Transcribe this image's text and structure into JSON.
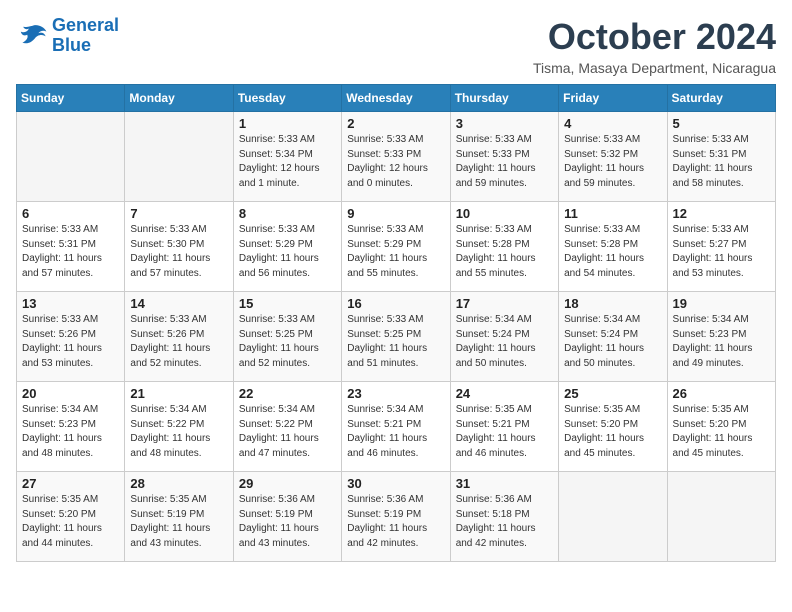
{
  "logo": {
    "line1": "General",
    "line2": "Blue"
  },
  "title": "October 2024",
  "location": "Tisma, Masaya Department, Nicaragua",
  "headers": [
    "Sunday",
    "Monday",
    "Tuesday",
    "Wednesday",
    "Thursday",
    "Friday",
    "Saturday"
  ],
  "weeks": [
    [
      {
        "day": "",
        "info": ""
      },
      {
        "day": "",
        "info": ""
      },
      {
        "day": "1",
        "info": "Sunrise: 5:33 AM\nSunset: 5:34 PM\nDaylight: 12 hours\nand 1 minute."
      },
      {
        "day": "2",
        "info": "Sunrise: 5:33 AM\nSunset: 5:33 PM\nDaylight: 12 hours\nand 0 minutes."
      },
      {
        "day": "3",
        "info": "Sunrise: 5:33 AM\nSunset: 5:33 PM\nDaylight: 11 hours\nand 59 minutes."
      },
      {
        "day": "4",
        "info": "Sunrise: 5:33 AM\nSunset: 5:32 PM\nDaylight: 11 hours\nand 59 minutes."
      },
      {
        "day": "5",
        "info": "Sunrise: 5:33 AM\nSunset: 5:31 PM\nDaylight: 11 hours\nand 58 minutes."
      }
    ],
    [
      {
        "day": "6",
        "info": "Sunrise: 5:33 AM\nSunset: 5:31 PM\nDaylight: 11 hours\nand 57 minutes."
      },
      {
        "day": "7",
        "info": "Sunrise: 5:33 AM\nSunset: 5:30 PM\nDaylight: 11 hours\nand 57 minutes."
      },
      {
        "day": "8",
        "info": "Sunrise: 5:33 AM\nSunset: 5:29 PM\nDaylight: 11 hours\nand 56 minutes."
      },
      {
        "day": "9",
        "info": "Sunrise: 5:33 AM\nSunset: 5:29 PM\nDaylight: 11 hours\nand 55 minutes."
      },
      {
        "day": "10",
        "info": "Sunrise: 5:33 AM\nSunset: 5:28 PM\nDaylight: 11 hours\nand 55 minutes."
      },
      {
        "day": "11",
        "info": "Sunrise: 5:33 AM\nSunset: 5:28 PM\nDaylight: 11 hours\nand 54 minutes."
      },
      {
        "day": "12",
        "info": "Sunrise: 5:33 AM\nSunset: 5:27 PM\nDaylight: 11 hours\nand 53 minutes."
      }
    ],
    [
      {
        "day": "13",
        "info": "Sunrise: 5:33 AM\nSunset: 5:26 PM\nDaylight: 11 hours\nand 53 minutes."
      },
      {
        "day": "14",
        "info": "Sunrise: 5:33 AM\nSunset: 5:26 PM\nDaylight: 11 hours\nand 52 minutes."
      },
      {
        "day": "15",
        "info": "Sunrise: 5:33 AM\nSunset: 5:25 PM\nDaylight: 11 hours\nand 52 minutes."
      },
      {
        "day": "16",
        "info": "Sunrise: 5:33 AM\nSunset: 5:25 PM\nDaylight: 11 hours\nand 51 minutes."
      },
      {
        "day": "17",
        "info": "Sunrise: 5:34 AM\nSunset: 5:24 PM\nDaylight: 11 hours\nand 50 minutes."
      },
      {
        "day": "18",
        "info": "Sunrise: 5:34 AM\nSunset: 5:24 PM\nDaylight: 11 hours\nand 50 minutes."
      },
      {
        "day": "19",
        "info": "Sunrise: 5:34 AM\nSunset: 5:23 PM\nDaylight: 11 hours\nand 49 minutes."
      }
    ],
    [
      {
        "day": "20",
        "info": "Sunrise: 5:34 AM\nSunset: 5:23 PM\nDaylight: 11 hours\nand 48 minutes."
      },
      {
        "day": "21",
        "info": "Sunrise: 5:34 AM\nSunset: 5:22 PM\nDaylight: 11 hours\nand 48 minutes."
      },
      {
        "day": "22",
        "info": "Sunrise: 5:34 AM\nSunset: 5:22 PM\nDaylight: 11 hours\nand 47 minutes."
      },
      {
        "day": "23",
        "info": "Sunrise: 5:34 AM\nSunset: 5:21 PM\nDaylight: 11 hours\nand 46 minutes."
      },
      {
        "day": "24",
        "info": "Sunrise: 5:35 AM\nSunset: 5:21 PM\nDaylight: 11 hours\nand 46 minutes."
      },
      {
        "day": "25",
        "info": "Sunrise: 5:35 AM\nSunset: 5:20 PM\nDaylight: 11 hours\nand 45 minutes."
      },
      {
        "day": "26",
        "info": "Sunrise: 5:35 AM\nSunset: 5:20 PM\nDaylight: 11 hours\nand 45 minutes."
      }
    ],
    [
      {
        "day": "27",
        "info": "Sunrise: 5:35 AM\nSunset: 5:20 PM\nDaylight: 11 hours\nand 44 minutes."
      },
      {
        "day": "28",
        "info": "Sunrise: 5:35 AM\nSunset: 5:19 PM\nDaylight: 11 hours\nand 43 minutes."
      },
      {
        "day": "29",
        "info": "Sunrise: 5:36 AM\nSunset: 5:19 PM\nDaylight: 11 hours\nand 43 minutes."
      },
      {
        "day": "30",
        "info": "Sunrise: 5:36 AM\nSunset: 5:19 PM\nDaylight: 11 hours\nand 42 minutes."
      },
      {
        "day": "31",
        "info": "Sunrise: 5:36 AM\nSunset: 5:18 PM\nDaylight: 11 hours\nand 42 minutes."
      },
      {
        "day": "",
        "info": ""
      },
      {
        "day": "",
        "info": ""
      }
    ]
  ]
}
